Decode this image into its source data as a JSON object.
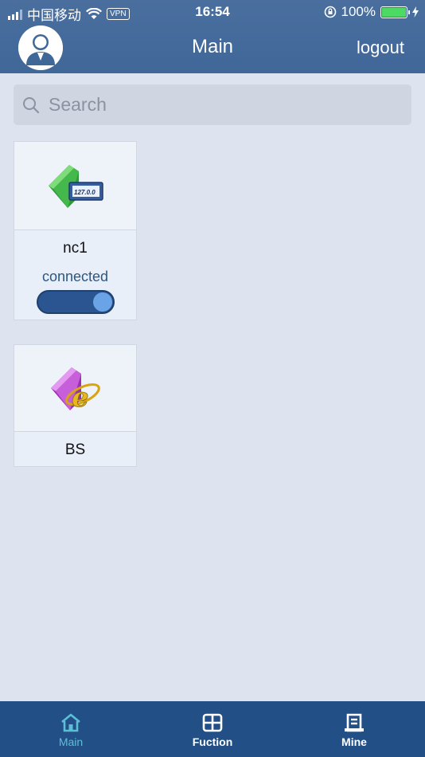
{
  "status_bar": {
    "carrier": "中国移动",
    "vpn": "VPN",
    "time": "16:54",
    "battery": "100%"
  },
  "header": {
    "title": "Main",
    "logout_label": "logout"
  },
  "search": {
    "placeholder": "Search"
  },
  "devices": [
    {
      "name": "nc1",
      "status": "connected",
      "toggle_on": true,
      "icon": "network-folder-icon",
      "icon_text": "127.0.0"
    },
    {
      "name": "BS",
      "icon": "browser-folder-icon",
      "icon_text": "e"
    }
  ],
  "tabs": [
    {
      "label": "Main",
      "icon": "home-icon",
      "active": true
    },
    {
      "label": "Fuction",
      "icon": "function-icon",
      "active": false
    },
    {
      "label": "Mine",
      "icon": "mine-icon",
      "active": false
    }
  ],
  "colors": {
    "header": "#3f6798",
    "background": "#dde4ef",
    "tabbar": "#234f87",
    "active_tab": "#5bc0d6",
    "toggle_track": "#2b5590",
    "toggle_knob": "#6aa3e6"
  }
}
